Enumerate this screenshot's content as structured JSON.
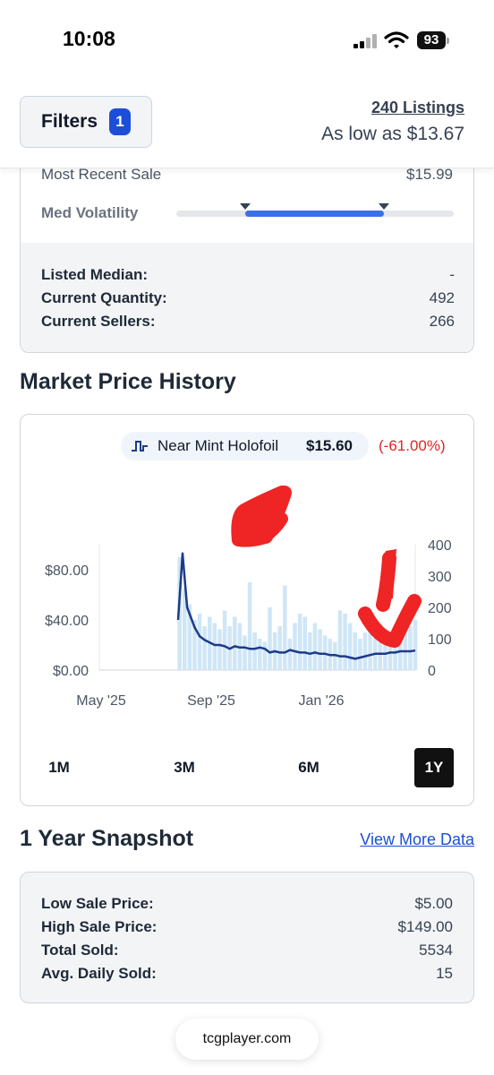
{
  "status_bar": {
    "time": "10:08",
    "battery": "93",
    "icons": [
      "signal-icon",
      "wifi-icon",
      "battery-icon"
    ]
  },
  "header": {
    "filters_label": "Filters",
    "filters_count": "1",
    "listings": "240 Listings",
    "low_price": "As low as $13.67"
  },
  "summary": {
    "recent_sale_label": "Most Recent Sale",
    "recent_sale_value": "$15.99",
    "volatility_label": "Med Volatility",
    "volatility_range": [
      0.25,
      0.75
    ],
    "stats": [
      {
        "label": "Listed Median:",
        "value": "-"
      },
      {
        "label": "Current Quantity:",
        "value": "492"
      },
      {
        "label": "Current Sellers:",
        "value": "266"
      }
    ]
  },
  "market": {
    "title": "Market Price History",
    "legend_name": "Near Mint Holofoil",
    "legend_price": "$15.60",
    "legend_change": "(-61.00%)",
    "ranges": [
      "1M",
      "3M",
      "6M",
      "1Y"
    ],
    "active_range": "1Y"
  },
  "chart_data": {
    "type": "line",
    "x_tick_labels": [
      "May '25",
      "Sep '25",
      "Jan '26"
    ],
    "y_left_ticks": [
      "$0.00",
      "$40.00",
      "$80.00"
    ],
    "y_left_range": [
      0,
      100
    ],
    "y_right_ticks": [
      "0",
      "100",
      "200",
      "300",
      "400"
    ],
    "y_right_range": [
      0,
      400
    ],
    "grid": false,
    "series": [
      {
        "kind": "line",
        "axis": "left",
        "color": "#1e3a8a",
        "values": [
          {
            "x": 0,
            "y": null
          },
          {
            "x": 1,
            "y": null
          },
          {
            "x": 2,
            "y": null
          },
          {
            "x": 3,
            "y": null
          },
          {
            "x": 4,
            "y": null
          },
          {
            "x": 5,
            "y": null
          },
          {
            "x": 6,
            "y": null
          },
          {
            "x": 7,
            "y": null
          },
          {
            "x": 8,
            "y": null
          },
          {
            "x": 9,
            "y": null
          },
          {
            "x": 10,
            "y": null
          },
          {
            "x": 11,
            "y": null
          },
          {
            "x": 12,
            "y": null
          },
          {
            "x": 13,
            "y": null
          },
          {
            "x": 14,
            "y": null
          },
          {
            "x": 15,
            "y": null
          },
          {
            "x": 15.7,
            "y": 40
          },
          {
            "x": 16.6,
            "y": 93
          },
          {
            "x": 17.5,
            "y": 50
          },
          {
            "x": 19,
            "y": 34
          },
          {
            "x": 20,
            "y": 27
          },
          {
            "x": 21,
            "y": 24
          },
          {
            "x": 22,
            "y": 22
          },
          {
            "x": 23,
            "y": 20
          },
          {
            "x": 24,
            "y": 20
          },
          {
            "x": 25,
            "y": 19
          },
          {
            "x": 26,
            "y": 17
          },
          {
            "x": 27,
            "y": 19
          },
          {
            "x": 28,
            "y": 18
          },
          {
            "x": 29,
            "y": 18
          },
          {
            "x": 30,
            "y": 17
          },
          {
            "x": 31,
            "y": 17
          },
          {
            "x": 32,
            "y": 18
          },
          {
            "x": 33,
            "y": 17
          },
          {
            "x": 34,
            "y": 14
          },
          {
            "x": 35,
            "y": 15
          },
          {
            "x": 36,
            "y": 14
          },
          {
            "x": 37,
            "y": 14
          },
          {
            "x": 38,
            "y": 16
          },
          {
            "x": 39,
            "y": 15
          },
          {
            "x": 40,
            "y": 14
          },
          {
            "x": 41,
            "y": 14
          },
          {
            "x": 42,
            "y": 13
          },
          {
            "x": 43,
            "y": 14
          },
          {
            "x": 44,
            "y": 13
          },
          {
            "x": 45,
            "y": 13
          },
          {
            "x": 46,
            "y": 12
          },
          {
            "x": 47,
            "y": 12
          },
          {
            "x": 48,
            "y": 11
          },
          {
            "x": 49,
            "y": 11
          },
          {
            "x": 50,
            "y": 10
          },
          {
            "x": 51,
            "y": 9
          },
          {
            "x": 52,
            "y": 10
          },
          {
            "x": 53,
            "y": 11
          },
          {
            "x": 54,
            "y": 12
          },
          {
            "x": 55,
            "y": 13
          },
          {
            "x": 56,
            "y": 13
          },
          {
            "x": 57,
            "y": 13
          },
          {
            "x": 58,
            "y": 14
          },
          {
            "x": 59,
            "y": 14
          },
          {
            "x": 60,
            "y": 15
          },
          {
            "x": 61,
            "y": 15
          },
          {
            "x": 62,
            "y": 15
          },
          {
            "x": 63,
            "y": 15.6
          }
        ]
      },
      {
        "kind": "bar",
        "axis": "right",
        "color": "#cfe6f6",
        "values": [
          {
            "x": 16,
            "y": 360
          },
          {
            "x": 17,
            "y": 260
          },
          {
            "x": 18,
            "y": 210
          },
          {
            "x": 19,
            "y": 160
          },
          {
            "x": 20,
            "y": 180
          },
          {
            "x": 21,
            "y": 140
          },
          {
            "x": 22,
            "y": 170
          },
          {
            "x": 23,
            "y": 150
          },
          {
            "x": 24,
            "y": 130
          },
          {
            "x": 25,
            "y": 190
          },
          {
            "x": 26,
            "y": 140
          },
          {
            "x": 27,
            "y": 170
          },
          {
            "x": 28,
            "y": 150
          },
          {
            "x": 29,
            "y": 110
          },
          {
            "x": 30,
            "y": 280
          },
          {
            "x": 31,
            "y": 120
          },
          {
            "x": 32,
            "y": 100
          },
          {
            "x": 33,
            "y": 90
          },
          {
            "x": 34,
            "y": 200
          },
          {
            "x": 35,
            "y": 120
          },
          {
            "x": 36,
            "y": 140
          },
          {
            "x": 37,
            "y": 270
          },
          {
            "x": 38,
            "y": 100
          },
          {
            "x": 39,
            "y": 150
          },
          {
            "x": 40,
            "y": 180
          },
          {
            "x": 41,
            "y": 170
          },
          {
            "x": 42,
            "y": 120
          },
          {
            "x": 43,
            "y": 150
          },
          {
            "x": 44,
            "y": 130
          },
          {
            "x": 45,
            "y": 110
          },
          {
            "x": 46,
            "y": 100
          },
          {
            "x": 47,
            "y": 90
          },
          {
            "x": 48,
            "y": 190
          },
          {
            "x": 49,
            "y": 180
          },
          {
            "x": 50,
            "y": 150
          },
          {
            "x": 51,
            "y": 120
          },
          {
            "x": 52,
            "y": 100
          },
          {
            "x": 53,
            "y": 120
          },
          {
            "x": 54,
            "y": 140
          },
          {
            "x": 55,
            "y": 160
          },
          {
            "x": 56,
            "y": 150
          },
          {
            "x": 57,
            "y": 130
          },
          {
            "x": 58,
            "y": 120
          },
          {
            "x": 59,
            "y": 100
          },
          {
            "x": 60,
            "y": 100
          },
          {
            "x": 61,
            "y": 120
          },
          {
            "x": 62,
            "y": 140
          },
          {
            "x": 63,
            "y": 160
          }
        ]
      }
    ],
    "annotations_color": "#ef2424"
  },
  "snapshot": {
    "title": "1 Year Snapshot",
    "view_more": "View More Data",
    "stats": [
      {
        "label": "Low Sale Price:",
        "value": "$5.00"
      },
      {
        "label": "High Sale Price:",
        "value": "$149.00"
      },
      {
        "label": "Total Sold:",
        "value": "5534"
      },
      {
        "label": "Avg. Daily Sold:",
        "value": "15"
      }
    ]
  },
  "browser": {
    "url": "tcgplayer.com"
  }
}
